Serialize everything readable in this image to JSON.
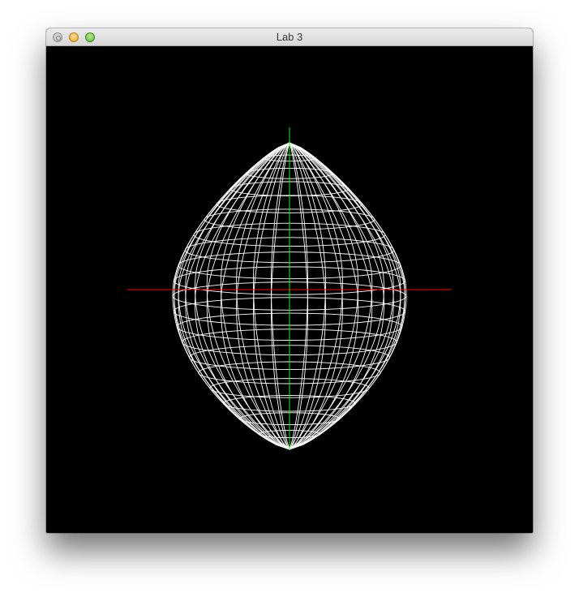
{
  "window": {
    "title": "Lab 3",
    "controls": {
      "close": "close-icon",
      "minimize": "minimize-icon",
      "zoom": "zoom-icon"
    }
  },
  "scene": {
    "background": "#000000",
    "mesh_color": "#ffffff",
    "x_axis_color": "#ff0000",
    "y_axis_color": "#00ff00",
    "object": "egg-wireframe"
  }
}
